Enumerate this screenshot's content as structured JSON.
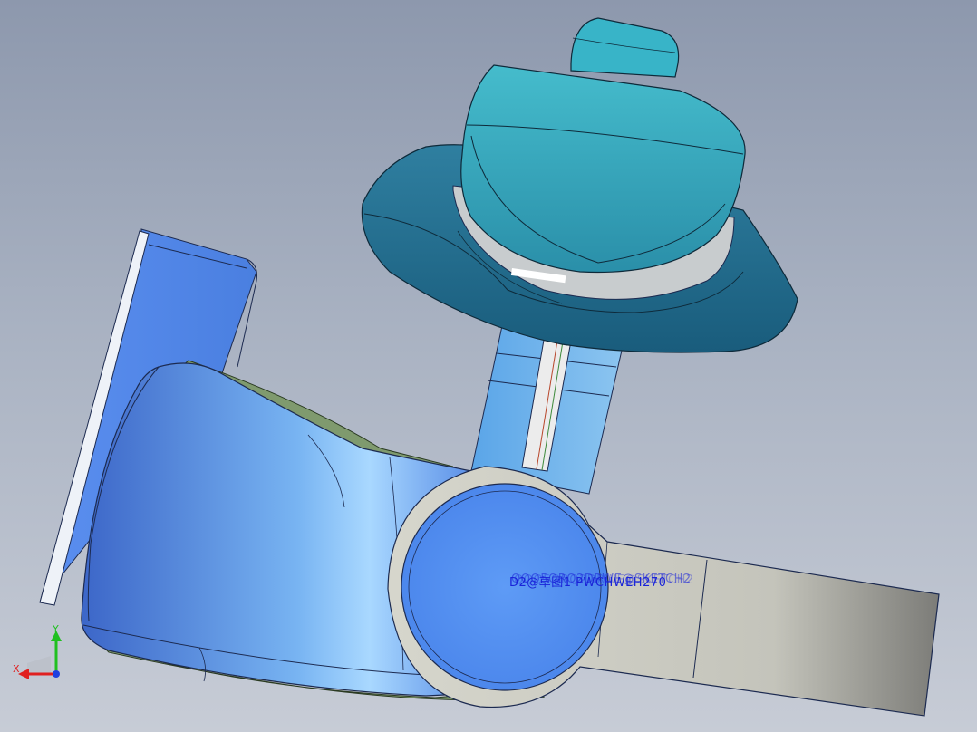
{
  "viewport": {
    "annotation_text": "D2@草图1 PWCHWEH270",
    "annotation_overlap_text": "QQQ5QRQ2DRWE@SKETCH2",
    "triad": {
      "x_label": "X",
      "y_label": "Y",
      "x_color": "#e02020",
      "y_color": "#20c020",
      "z_color": "#2040e0"
    }
  },
  "colors": {
    "background_top": "#8d98ad",
    "background_bottom": "#c7ccd6",
    "body_blue": "#4f86ea",
    "lid_teal": "#2aa1b8",
    "dish_dark_teal": "#1e6e8c",
    "arm_gray": "#cfcfc4",
    "strip_light_blue": "#6aaee6",
    "green_trim": "#8aa878"
  }
}
